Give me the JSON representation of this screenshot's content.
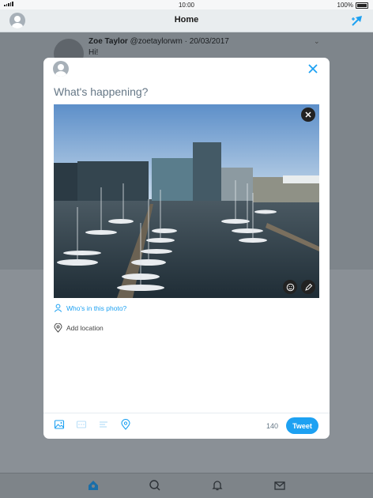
{
  "status_bar": {
    "time": "10:00",
    "battery": "100%"
  },
  "nav": {
    "title": "Home"
  },
  "feed": {
    "tweet": {
      "name": "Zoe Taylor",
      "handle": "@zoetaylorwm",
      "date": "20/03/2017",
      "text": "Hi!"
    }
  },
  "compose": {
    "prompt": "What's happening?",
    "tag_people": "Who's in this photo?",
    "add_location": "Add location",
    "char_count": "140",
    "tweet_button": "Tweet"
  },
  "colors": {
    "accent": "#1da1f2",
    "overlay": "#8a9096"
  },
  "icons": {
    "nav": [
      "avatar",
      "compose-icon"
    ],
    "compose_toolbar": [
      "image-icon",
      "gif-icon",
      "poll-icon",
      "location-icon"
    ],
    "tabbar": [
      "home-icon",
      "search-icon",
      "notifications-icon",
      "messages-icon"
    ]
  }
}
